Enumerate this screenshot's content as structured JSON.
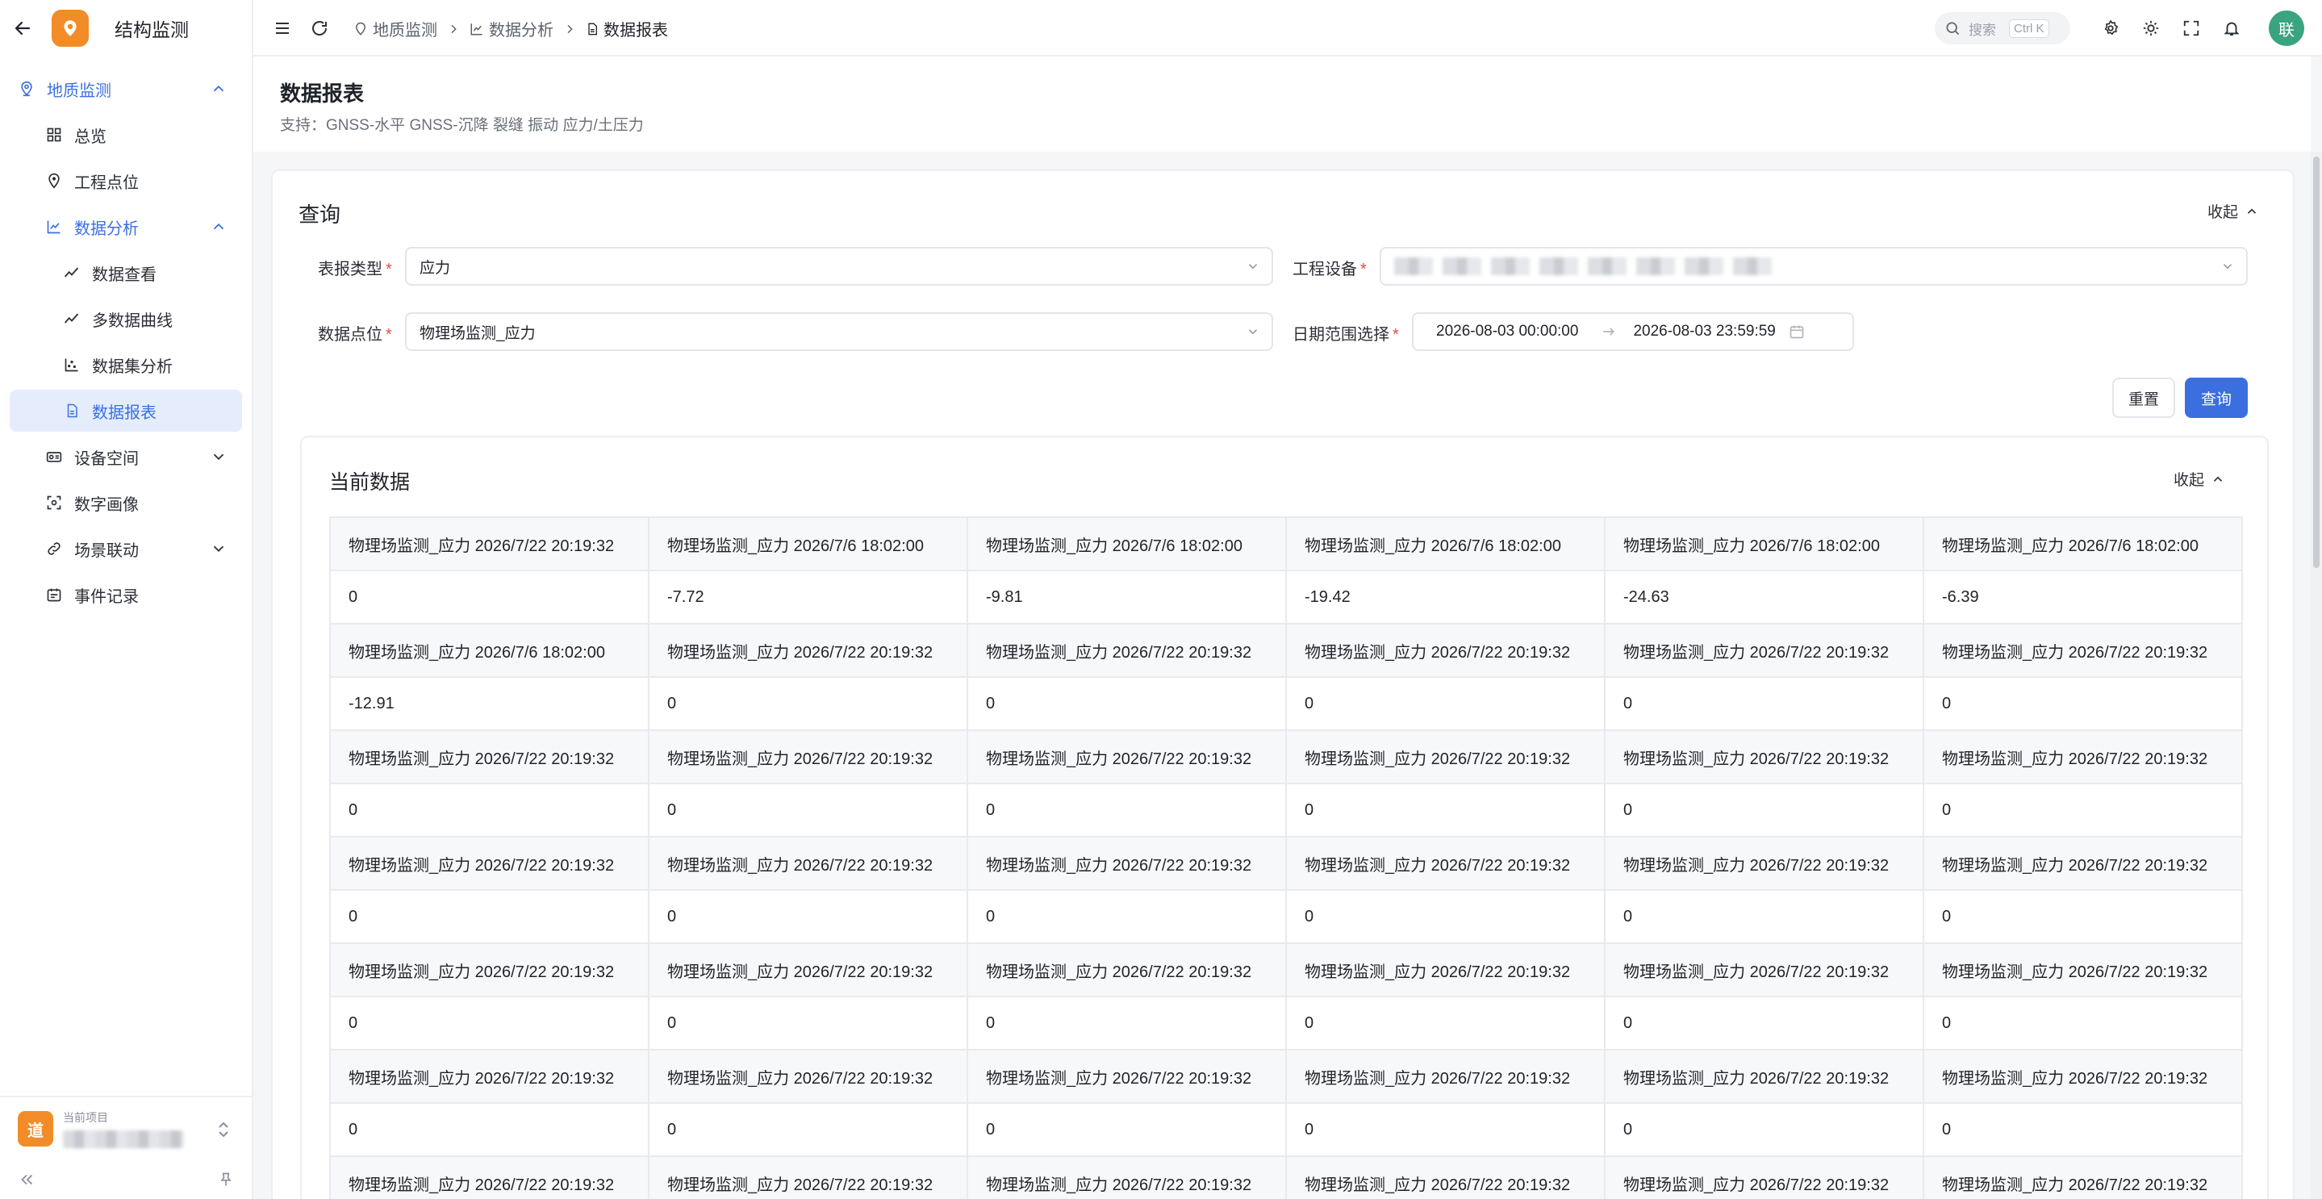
{
  "app": {
    "name": "结构监测"
  },
  "sidebar": {
    "items": [
      {
        "label": "地质监测",
        "icon": "location-pin-icon",
        "level": 1,
        "state": "open-blue"
      },
      {
        "label": "总览",
        "icon": "dashboard-grid-icon",
        "level": 2
      },
      {
        "label": "工程点位",
        "icon": "map-pin-icon",
        "level": 2
      },
      {
        "label": "数据分析",
        "icon": "line-chart-icon",
        "level": 2,
        "state": "open-blue"
      },
      {
        "label": "数据查看",
        "icon": "trend-line-icon",
        "level": 3
      },
      {
        "label": "多数据曲线",
        "icon": "trend-line-icon",
        "level": 3
      },
      {
        "label": "数据集分析",
        "icon": "scatter-chart-icon",
        "level": 3
      },
      {
        "label": "数据报表",
        "icon": "report-file-icon",
        "level": 3,
        "state": "active"
      },
      {
        "label": "设备空间",
        "icon": "device-icon",
        "level": 2
      },
      {
        "label": "数字画像",
        "icon": "scan-icon",
        "level": 2
      },
      {
        "label": "场景联动",
        "icon": "link-icon",
        "level": 2
      },
      {
        "label": "事件记录",
        "icon": "calendar-record-icon",
        "level": 2
      }
    ],
    "project": {
      "label": "当前项目",
      "badge": "道"
    }
  },
  "header": {
    "breadcrumb": [
      "地质监测",
      "数据分析",
      "数据报表"
    ],
    "search_placeholder": "搜索",
    "search_shortcut": "Ctrl K",
    "avatar_text": "联"
  },
  "page": {
    "title": "数据报表",
    "subtitle": "支持：GNSS-水平 GNSS-沉降 裂缝 振动 应力/土压力"
  },
  "query": {
    "title": "查询",
    "collapse_label": "收起",
    "report_type_label": "表报类型",
    "report_type_value": "应力",
    "device_label": "工程设备",
    "point_label": "数据点位",
    "point_value": "物理场监测_应力",
    "date_label": "日期范围选择",
    "date_start": "2026-08-03 00:00:00",
    "date_end": "2026-08-03 23:59:59",
    "reset_label": "重置",
    "search_label": "查询"
  },
  "current": {
    "title": "当前数据",
    "collapse_label": "收起",
    "rows": [
      [
        "物理场监测_应力 2026/7/22 20:19:32",
        "物理场监测_应力 2026/7/6 18:02:00",
        "物理场监测_应力 2026/7/6 18:02:00",
        "物理场监测_应力 2026/7/6 18:02:00",
        "物理场监测_应力 2026/7/6 18:02:00",
        "物理场监测_应力 2026/7/6 18:02:00"
      ],
      [
        "0",
        "-7.72",
        "-9.81",
        "-19.42",
        "-24.63",
        "-6.39"
      ],
      [
        "物理场监测_应力 2026/7/6 18:02:00",
        "物理场监测_应力 2026/7/22 20:19:32",
        "物理场监测_应力 2026/7/22 20:19:32",
        "物理场监测_应力 2026/7/22 20:19:32",
        "物理场监测_应力 2026/7/22 20:19:32",
        "物理场监测_应力 2026/7/22 20:19:32"
      ],
      [
        "-12.91",
        "0",
        "0",
        "0",
        "0",
        "0"
      ],
      [
        "物理场监测_应力 2026/7/22 20:19:32",
        "物理场监测_应力 2026/7/22 20:19:32",
        "物理场监测_应力 2026/7/22 20:19:32",
        "物理场监测_应力 2026/7/22 20:19:32",
        "物理场监测_应力 2026/7/22 20:19:32",
        "物理场监测_应力 2026/7/22 20:19:32"
      ],
      [
        "0",
        "0",
        "0",
        "0",
        "0",
        "0"
      ],
      [
        "物理场监测_应力 2026/7/22 20:19:32",
        "物理场监测_应力 2026/7/22 20:19:32",
        "物理场监测_应力 2026/7/22 20:19:32",
        "物理场监测_应力 2026/7/22 20:19:32",
        "物理场监测_应力 2026/7/22 20:19:32",
        "物理场监测_应力 2026/7/22 20:19:32"
      ],
      [
        "0",
        "0",
        "0",
        "0",
        "0",
        "0"
      ],
      [
        "物理场监测_应力 2026/7/22 20:19:32",
        "物理场监测_应力 2026/7/22 20:19:32",
        "物理场监测_应力 2026/7/22 20:19:32",
        "物理场监测_应力 2026/7/22 20:19:32",
        "物理场监测_应力 2026/7/22 20:19:32",
        "物理场监测_应力 2026/7/22 20:19:32"
      ],
      [
        "0",
        "0",
        "0",
        "0",
        "0",
        "0"
      ],
      [
        "物理场监测_应力 2026/7/22 20:19:32",
        "物理场监测_应力 2026/7/22 20:19:32",
        "物理场监测_应力 2026/7/22 20:19:32",
        "物理场监测_应力 2026/7/22 20:19:32",
        "物理场监测_应力 2026/7/22 20:19:32",
        "物理场监测_应力 2026/7/22 20:19:32"
      ],
      [
        "0",
        "0",
        "0",
        "0",
        "0",
        "0"
      ],
      [
        "物理场监测_应力 2026/7/22 20:19:32",
        "物理场监测_应力 2026/7/22 20:19:32",
        "物理场监测_应力 2026/7/22 20:19:32",
        "物理场监测_应力 2026/7/22 20:19:32",
        "物理场监测_应力 2026/7/22 20:19:32",
        "物理场监测_应力 2026/7/22 20:19:32"
      ]
    ]
  }
}
